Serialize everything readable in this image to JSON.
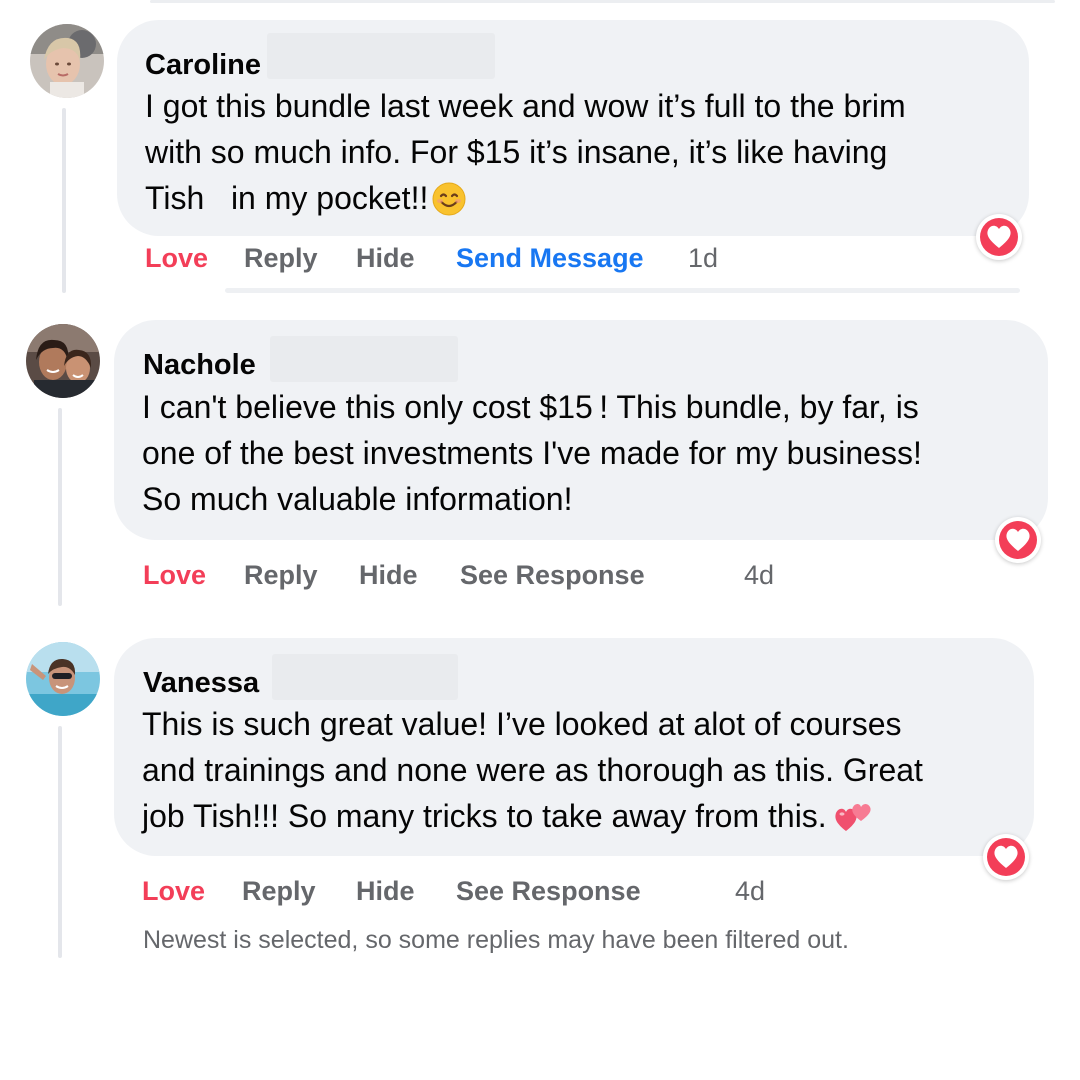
{
  "colors": {
    "bubble": "#f0f2f5",
    "love": "#f33e58",
    "link": "#1877f2",
    "muted": "#65676b",
    "text": "#050505"
  },
  "comments": [
    {
      "author": "Caroline",
      "lines": [
        "I got this bundle last week and wow it’s full to the brim",
        "with so much info. For $15  it’s insane, it’s like having",
        "Tish   in my pocket!!"
      ],
      "emoji": "smiling-face-emoji",
      "reaction": "love-reaction-icon",
      "actions": {
        "love": "Love",
        "reply": "Reply",
        "hide": "Hide",
        "extra": "Send Message"
      },
      "time": "1d"
    },
    {
      "author": "Nachole",
      "lines": [
        "I can't believe this only cost $15 ! This bundle, by far, is",
        "one of the best investments I've made for my business!",
        "So much valuable information!"
      ],
      "reaction": "love-reaction-icon",
      "actions": {
        "love": "Love",
        "reply": "Reply",
        "hide": "Hide",
        "extra": "See Response"
      },
      "time": "4d"
    },
    {
      "author": "Vanessa",
      "lines": [
        "This is such great value! I’ve looked at alot of courses",
        "and trainings and none were as thorough as this. Great",
        "job Tish!!! So many tricks to take away from this."
      ],
      "emoji": "two-hearts-emoji",
      "reaction": "love-reaction-icon",
      "actions": {
        "love": "Love",
        "reply": "Reply",
        "hide": "Hide",
        "extra": "See Response"
      },
      "time": "4d"
    }
  ],
  "filter_note": "Newest is selected, so some replies may have been filtered out."
}
